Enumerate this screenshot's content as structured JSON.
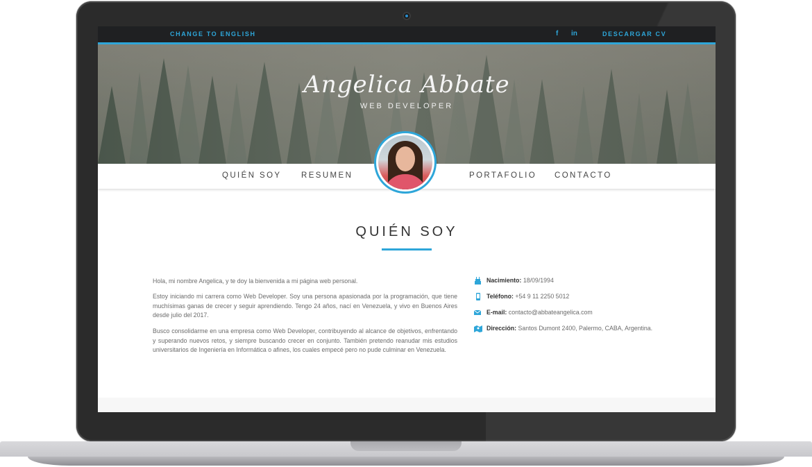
{
  "topbar": {
    "lang_link": "CHANGE TO ENGLISH",
    "facebook_icon": "f",
    "linkedin_icon": "in",
    "cv_link": "DESCARGAR CV"
  },
  "hero": {
    "name": "Angelica Abbate",
    "role": "WEB DEVELOPER"
  },
  "nav": {
    "items": [
      "QUIÉN SOY",
      "RESUMEN",
      "PORTAFOLIO",
      "CONTACTO"
    ]
  },
  "about": {
    "title": "QUIÉN SOY",
    "paragraphs": [
      "Hola, mi nombre Angelica, y te doy la bienvenida a mi página web personal.",
      "Estoy iniciando mi carrera como Web Developer. Soy una persona apasionada por la programación, que tiene muchísimas ganas de crecer y seguir aprendiendo. Tengo 24 años, nací en Venezuela, y vivo en Buenos Aires desde julio del 2017.",
      "Busco consolidarme en una empresa como Web Developer, contribuyendo al alcance de objetivos, enfrentando y superando nuevos retos, y siempre buscando crecer en conjunto. También pretendo reanudar mis estudios universitarios de Ingeniería en Informática o afines, los cuales empecé pero no pude culminar en Venezuela."
    ],
    "info": [
      {
        "icon": "cake-icon",
        "label": "Nacimiento:",
        "value": "18/09/1994"
      },
      {
        "icon": "phone-icon",
        "label": "Teléfono:",
        "value": "+54 9 11 2250 5012"
      },
      {
        "icon": "mail-icon",
        "label": "E-mail:",
        "value": "contacto@abbateangelica.com"
      },
      {
        "icon": "map-icon",
        "label": "Dirección:",
        "value": "Santos Dumont 2400, Palermo, CABA, Argentina."
      }
    ]
  },
  "colors": {
    "accent": "#2ea6d9",
    "topbar_bg": "#1f2022"
  }
}
